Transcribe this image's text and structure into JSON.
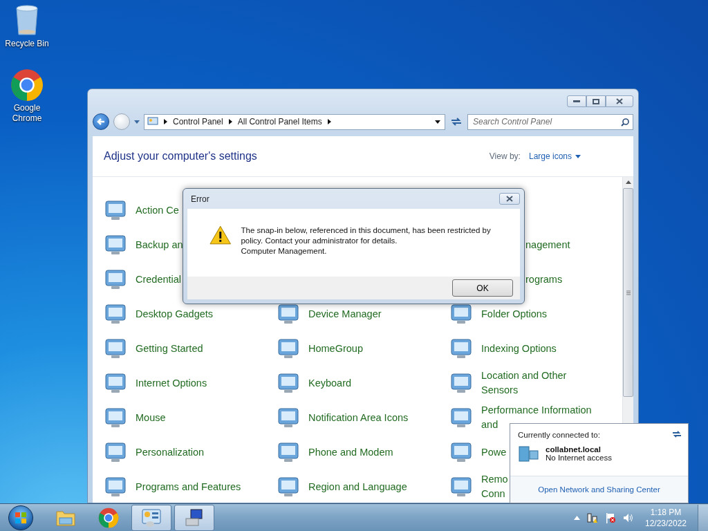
{
  "desktop_icons": [
    {
      "kind": "bin",
      "label": "Recycle Bin"
    },
    {
      "kind": "chrome",
      "label": "Google Chrome"
    }
  ],
  "window": {
    "breadcrumb": [
      "Control Panel",
      "All Control Panel Items"
    ],
    "search": {
      "placeholder": "Search Control Panel"
    },
    "heading": "Adjust your computer's settings",
    "view_by": {
      "label": "View by:",
      "value": "Large icons"
    },
    "items": [
      {
        "kind": "applet",
        "lines": [
          "Action Ce"
        ]
      },
      {
        "kind": "empty"
      },
      {
        "kind": "empty"
      },
      {
        "kind": "applet",
        "lines": [
          "Backup an"
        ]
      },
      {
        "kind": "empty"
      },
      {
        "kind": "fragment",
        "lines": [
          "nagement"
        ]
      },
      {
        "kind": "applet",
        "lines": [
          "Credential"
        ]
      },
      {
        "kind": "empty"
      },
      {
        "kind": "fragment",
        "lines": [
          "rograms"
        ]
      },
      {
        "kind": "applet",
        "lines": [
          "Desktop Gadgets"
        ]
      },
      {
        "kind": "applet",
        "lines": [
          "Device Manager"
        ]
      },
      {
        "kind": "applet",
        "lines": [
          "Folder Options"
        ]
      },
      {
        "kind": "applet",
        "lines": [
          "Getting Started"
        ]
      },
      {
        "kind": "applet",
        "lines": [
          "HomeGroup"
        ]
      },
      {
        "kind": "applet",
        "lines": [
          "Indexing Options"
        ]
      },
      {
        "kind": "applet",
        "lines": [
          "Internet Options"
        ]
      },
      {
        "kind": "applet",
        "lines": [
          "Keyboard"
        ]
      },
      {
        "kind": "applet",
        "lines": [
          "Location and Other",
          "Sensors"
        ]
      },
      {
        "kind": "applet",
        "lines": [
          "Mouse"
        ]
      },
      {
        "kind": "applet",
        "lines": [
          "Notification Area Icons"
        ]
      },
      {
        "kind": "applet",
        "lines": [
          "Performance Information",
          "and"
        ]
      },
      {
        "kind": "applet",
        "lines": [
          "Personalization"
        ]
      },
      {
        "kind": "applet",
        "lines": [
          "Phone and Modem"
        ]
      },
      {
        "kind": "applet",
        "lines": [
          "Powe"
        ]
      },
      {
        "kind": "applet",
        "lines": [
          "Programs and Features"
        ]
      },
      {
        "kind": "applet",
        "lines": [
          "Region and Language"
        ]
      },
      {
        "kind": "applet",
        "lines": [
          "Remo",
          "Conn"
        ]
      }
    ]
  },
  "dialog": {
    "title": "Error",
    "message": [
      "The snap-in below, referenced in this document, has been restricted by policy. Contact your administrator for details.",
      "Computer Management."
    ],
    "button": "OK"
  },
  "network_popup": {
    "heading": "Currently connected to:",
    "network": "collabnet.local",
    "status": "No Internet access",
    "link": "Open Network and Sharing Center"
  },
  "taskbar": {
    "buttons": [
      {
        "kind": "explorer",
        "open": false
      },
      {
        "kind": "chrome",
        "open": false
      },
      {
        "kind": "control-panel",
        "open": true
      },
      {
        "kind": "computer-management",
        "open": true
      }
    ],
    "clock": {
      "time": "1:18 PM",
      "date": "12/23/2022"
    }
  }
}
